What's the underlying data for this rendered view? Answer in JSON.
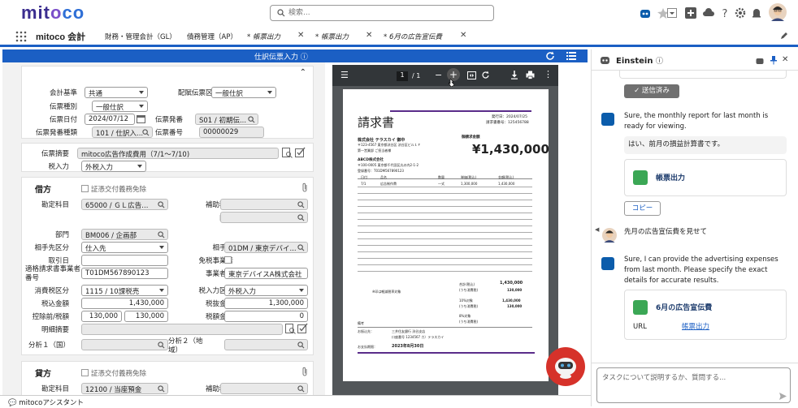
{
  "header": {
    "logo": "mitoco",
    "search_placeholder": "検索..."
  },
  "nav": {
    "app_name": "mitoco 会計",
    "items": [
      "財務・管理会計（GL）",
      "債務管理（AP）"
    ],
    "tabs": [
      "帳票出力",
      "帳票出力",
      "6月の広告宣伝費"
    ]
  },
  "form": {
    "title": "仕訳伝票入力",
    "header_fields": {
      "kaikei_kijun_label": "会計基準",
      "kaikei_kijun": "共通",
      "haizoku_label": "配賦伝票区分",
      "haizoku": "一般仕訳",
      "denpyo_shubetsu_label": "伝票種別",
      "denpyo_shubetsu": "一般仕訳",
      "denpyo_date_label": "伝票日付",
      "denpyo_date": "2024/07/12",
      "hakkomoto_label": "伝票発番",
      "hakkomoto": "S01 / 初期伝...",
      "hakko_shurui_label": "伝票発番種類",
      "hakko_shurui": "101 / 仕訳入...",
      "denpyo_no_label": "伝票番号",
      "denpyo_no": "00000029"
    },
    "summary": {
      "tekiyo_label": "伝票摘要",
      "tekiyo": "mitoco広告作成費用（7/1〜7/10)",
      "zeinyuryoku_label": "税入力",
      "zeinyuryoku": "外税入力"
    },
    "debit": {
      "section": "借方",
      "shoshou_label": "証憑交付義務免除",
      "kanjo_label": "勘定科目",
      "kanjo": "65000 / ＧＬ広告...",
      "hojo_label": "補助科目",
      "uchiwake_label": "内訳",
      "bumon_label": "部門",
      "bumon": "BM006 / 企画部",
      "aite_kubun_label": "相手先区分",
      "aite_kubun": "仕入先",
      "aite_label": "相手先",
      "aite": "01DM / 東京デバイ...",
      "torihiki_label": "取引日",
      "menzei_label": "免税事業者",
      "tekikaku_label": "適格請求書事業者番号",
      "tekikaku": "T01DM567890123",
      "jigyosha_label": "事業者名",
      "jigyosha": "東京デバイスA株式会社",
      "shohizei_label": "消費税区分",
      "shohizei": "1115 / 10課税売",
      "zeinyu_kubun_label": "税入力区分",
      "zeinyu_kubun": "外税入力",
      "zeikomi_label": "税込金額",
      "zeikomi": "1,430,000",
      "zeinuki_label": "税抜金額",
      "zeinuki": "1,300,000",
      "kojo_label": "控除前/税額",
      "kojo1": "130,000",
      "kojo2": "130,000",
      "zeigaku_label": "税額金額",
      "zeigaku": "0",
      "meisai_label": "明細摘要",
      "bunseki1_label": "分析１（国）",
      "bunseki2_label": "分析２（地域）"
    },
    "credit": {
      "section": "貸方",
      "shoshou_label": "証憑交付義務免除",
      "kanjo_label": "勘定科目",
      "kanjo": "12100 / 当座預金",
      "hojo_label": "補助科目"
    }
  },
  "pdf": {
    "page_current": "1",
    "page_total": "/ 1",
    "title": "請求書",
    "issue_date": "発行日：2024/07/25",
    "invoice_no": "請求書番号：125456788",
    "to_company": "株式会社 テラスカイ 御中",
    "to_addr": "〒123-4567 東京都渋谷区 渋谷区ビル１Ｆ",
    "to_dept": "第一営業部 ご担当者様",
    "amount_label": "御請求金額",
    "amount": "¥1,430,000",
    "from_company": "ABCD株式会社",
    "from_addr": "〒100-0005 東京都千代田区丸の内2-1-2",
    "reg_no": "登録番号：T01DM567890123",
    "cols": [
      "日付",
      "品名",
      "数量",
      "単価(税込)",
      "金額(税込)"
    ],
    "row": [
      "7/1",
      "広告制作費",
      "一式",
      "1,300,000",
      "1,430,000"
    ],
    "reduced_note": "※印は軽減税率対象",
    "subtotal_label": "合計(税込)",
    "subtotal": "1,430,000",
    "tax_label": "(うち消費税)",
    "tax": "130,000",
    "rate10_label": "10%対象",
    "rate10": "1,430,000",
    "rate10_tax": "130,000",
    "rate8_label": "8%対象",
    "rate8": "0",
    "notes_label": "備考",
    "bank_label": "お振込先：",
    "bank": "三井住友銀行 渋谷支店",
    "account": "口座番号 1234567 カ）テラスカイ",
    "due_label": "お支払期限：",
    "due": "2023年8月30日"
  },
  "einstein": {
    "title": "Einstein",
    "sent_button": "送信済み",
    "msg1": "Sure, the monthly report for last month is ready for viewing.",
    "msg1_sub": "はい、前月の損益計算書です。",
    "card1_title": "帳票出力",
    "copy_button": "コピー",
    "user_msg": "先月の広告宣伝費を見せて",
    "msg2": "Sure, I can provide the advertising expenses from last month. Please specify the exact details for accurate results.",
    "card2_title": "6月の広告宣伝費",
    "card2_url_label": "URL",
    "card2_url_link": "帳票出力",
    "input_placeholder": "タスクについて説明するか、質問する..."
  },
  "bottom": {
    "assistant_label": "mitocoアシスタント"
  },
  "colors": {
    "brand_blue": "#1b5fc4",
    "brand_purple": "#3b2d8f",
    "green_icon": "#3ba755",
    "robot_red": "#d6322a"
  }
}
